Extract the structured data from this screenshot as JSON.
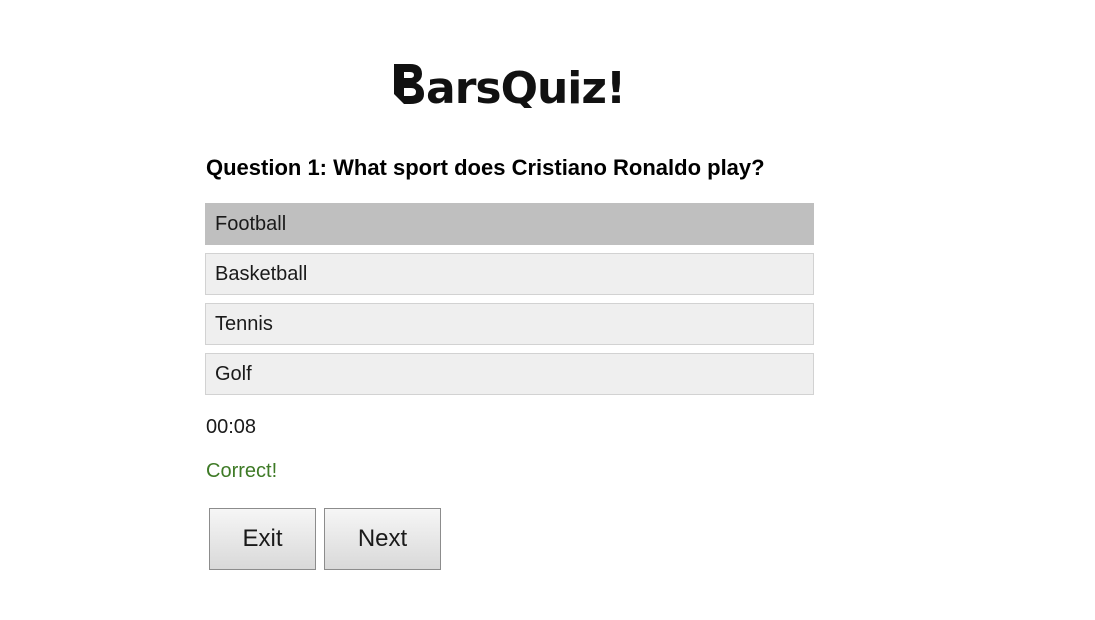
{
  "logo": {
    "text": "BarsQuiz!"
  },
  "quiz": {
    "question": "Question 1: What sport does Cristiano Ronaldo play?",
    "answers": [
      {
        "label": "Football",
        "selected": true
      },
      {
        "label": "Basketball",
        "selected": false
      },
      {
        "label": "Tennis",
        "selected": false
      },
      {
        "label": "Golf",
        "selected": false
      }
    ],
    "timer": "00:08",
    "feedback": "Correct!",
    "feedback_color": "#3e7a26"
  },
  "buttons": {
    "exit_label": "Exit",
    "next_label": "Next"
  }
}
